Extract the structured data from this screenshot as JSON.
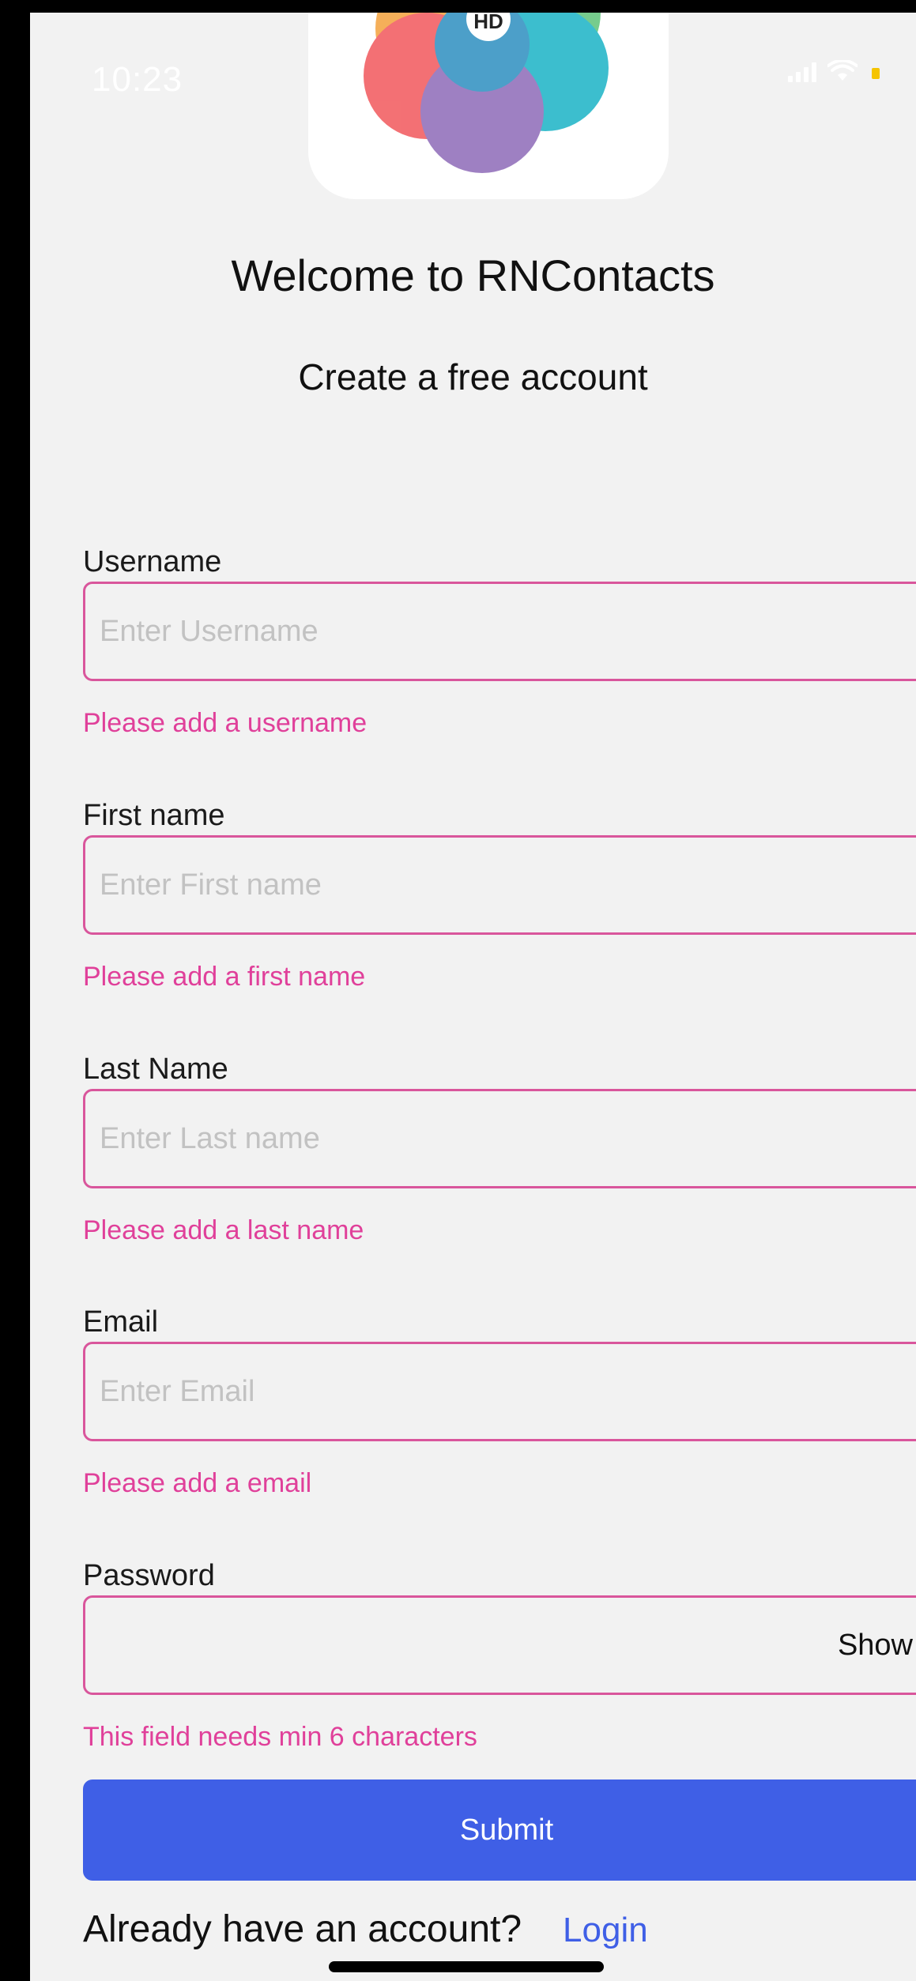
{
  "status_bar": {
    "time": "10:23"
  },
  "logo": {
    "badge_text": "HD"
  },
  "header": {
    "title": "Welcome to RNContacts",
    "subtitle": "Create a free account"
  },
  "form": {
    "username": {
      "label": "Username",
      "placeholder": "Enter Username",
      "value": "",
      "error": "Please add a username"
    },
    "first_name": {
      "label": "First name",
      "placeholder": "Enter First name",
      "value": "",
      "error": "Please add a  first name"
    },
    "last_name": {
      "label": "Last Name",
      "placeholder": "Enter Last name",
      "value": "",
      "error": "Please add a last name"
    },
    "email": {
      "label": "Email",
      "placeholder": "Enter Email",
      "value": "",
      "error": "Please add a email"
    },
    "password": {
      "label": "Password",
      "value": "",
      "toggle_label": "Show",
      "error": "This field needs min 6 characters"
    },
    "submit_label": "Submit"
  },
  "footer": {
    "prompt": "Already have an account?",
    "login_label": "Login"
  },
  "colors": {
    "accent": "#3f5fe6",
    "error": "#e0409a",
    "input_border": "#d9569c",
    "background": "#f2f2f2",
    "battery": "#f5c400"
  },
  "icons": [
    "app-logo-icon",
    "signal-icon",
    "wifi-icon",
    "battery-icon"
  ]
}
